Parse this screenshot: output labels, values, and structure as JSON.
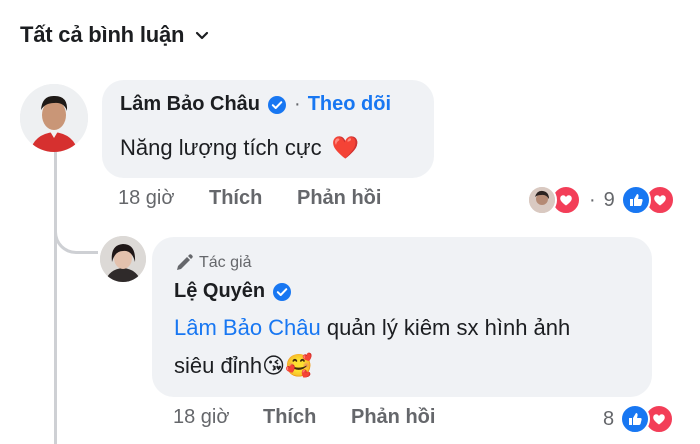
{
  "header": {
    "title": "Tất cả bình luận"
  },
  "comment1": {
    "author": "Lâm Bảo Châu",
    "separator": "·",
    "follow_label": "Theo dõi",
    "text": "Năng lượng tích cực",
    "emoji": "❤️",
    "time": "18 giờ",
    "like_label": "Thích",
    "reply_label": "Phản hồi",
    "reaction_separator": "·",
    "reaction_count": "9"
  },
  "comment2": {
    "author_tag": "Tác giả",
    "author": "Lệ Quyên",
    "mention": "Lâm Bảo Châu",
    "text_line1": " quản lý kiêm sx hình ảnh",
    "text_line2": "siêu đỉnh",
    "emoji": "😘🥰",
    "time": "18 giờ",
    "like_label": "Thích",
    "reply_label": "Phản hồi",
    "reaction_count": "8"
  },
  "colors": {
    "link": "#1877f2",
    "secondary_text": "#65676b",
    "bubble": "#f0f2f5",
    "like": "#1877f2",
    "love": "#f33e58"
  }
}
